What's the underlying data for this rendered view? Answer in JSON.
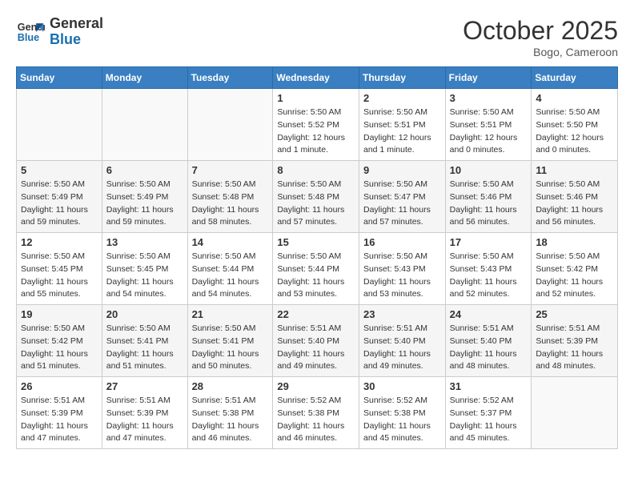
{
  "header": {
    "logo_line1": "General",
    "logo_line2": "Blue",
    "month": "October 2025",
    "location": "Bogo, Cameroon"
  },
  "weekdays": [
    "Sunday",
    "Monday",
    "Tuesday",
    "Wednesday",
    "Thursday",
    "Friday",
    "Saturday"
  ],
  "weeks": [
    [
      {
        "day": "",
        "info": ""
      },
      {
        "day": "",
        "info": ""
      },
      {
        "day": "",
        "info": ""
      },
      {
        "day": "1",
        "info": "Sunrise: 5:50 AM\nSunset: 5:52 PM\nDaylight: 12 hours\nand 1 minute."
      },
      {
        "day": "2",
        "info": "Sunrise: 5:50 AM\nSunset: 5:51 PM\nDaylight: 12 hours\nand 1 minute."
      },
      {
        "day": "3",
        "info": "Sunrise: 5:50 AM\nSunset: 5:51 PM\nDaylight: 12 hours\nand 0 minutes."
      },
      {
        "day": "4",
        "info": "Sunrise: 5:50 AM\nSunset: 5:50 PM\nDaylight: 12 hours\nand 0 minutes."
      }
    ],
    [
      {
        "day": "5",
        "info": "Sunrise: 5:50 AM\nSunset: 5:49 PM\nDaylight: 11 hours\nand 59 minutes."
      },
      {
        "day": "6",
        "info": "Sunrise: 5:50 AM\nSunset: 5:49 PM\nDaylight: 11 hours\nand 59 minutes."
      },
      {
        "day": "7",
        "info": "Sunrise: 5:50 AM\nSunset: 5:48 PM\nDaylight: 11 hours\nand 58 minutes."
      },
      {
        "day": "8",
        "info": "Sunrise: 5:50 AM\nSunset: 5:48 PM\nDaylight: 11 hours\nand 57 minutes."
      },
      {
        "day": "9",
        "info": "Sunrise: 5:50 AM\nSunset: 5:47 PM\nDaylight: 11 hours\nand 57 minutes."
      },
      {
        "day": "10",
        "info": "Sunrise: 5:50 AM\nSunset: 5:46 PM\nDaylight: 11 hours\nand 56 minutes."
      },
      {
        "day": "11",
        "info": "Sunrise: 5:50 AM\nSunset: 5:46 PM\nDaylight: 11 hours\nand 56 minutes."
      }
    ],
    [
      {
        "day": "12",
        "info": "Sunrise: 5:50 AM\nSunset: 5:45 PM\nDaylight: 11 hours\nand 55 minutes."
      },
      {
        "day": "13",
        "info": "Sunrise: 5:50 AM\nSunset: 5:45 PM\nDaylight: 11 hours\nand 54 minutes."
      },
      {
        "day": "14",
        "info": "Sunrise: 5:50 AM\nSunset: 5:44 PM\nDaylight: 11 hours\nand 54 minutes."
      },
      {
        "day": "15",
        "info": "Sunrise: 5:50 AM\nSunset: 5:44 PM\nDaylight: 11 hours\nand 53 minutes."
      },
      {
        "day": "16",
        "info": "Sunrise: 5:50 AM\nSunset: 5:43 PM\nDaylight: 11 hours\nand 53 minutes."
      },
      {
        "day": "17",
        "info": "Sunrise: 5:50 AM\nSunset: 5:43 PM\nDaylight: 11 hours\nand 52 minutes."
      },
      {
        "day": "18",
        "info": "Sunrise: 5:50 AM\nSunset: 5:42 PM\nDaylight: 11 hours\nand 52 minutes."
      }
    ],
    [
      {
        "day": "19",
        "info": "Sunrise: 5:50 AM\nSunset: 5:42 PM\nDaylight: 11 hours\nand 51 minutes."
      },
      {
        "day": "20",
        "info": "Sunrise: 5:50 AM\nSunset: 5:41 PM\nDaylight: 11 hours\nand 51 minutes."
      },
      {
        "day": "21",
        "info": "Sunrise: 5:50 AM\nSunset: 5:41 PM\nDaylight: 11 hours\nand 50 minutes."
      },
      {
        "day": "22",
        "info": "Sunrise: 5:51 AM\nSunset: 5:40 PM\nDaylight: 11 hours\nand 49 minutes."
      },
      {
        "day": "23",
        "info": "Sunrise: 5:51 AM\nSunset: 5:40 PM\nDaylight: 11 hours\nand 49 minutes."
      },
      {
        "day": "24",
        "info": "Sunrise: 5:51 AM\nSunset: 5:40 PM\nDaylight: 11 hours\nand 48 minutes."
      },
      {
        "day": "25",
        "info": "Sunrise: 5:51 AM\nSunset: 5:39 PM\nDaylight: 11 hours\nand 48 minutes."
      }
    ],
    [
      {
        "day": "26",
        "info": "Sunrise: 5:51 AM\nSunset: 5:39 PM\nDaylight: 11 hours\nand 47 minutes."
      },
      {
        "day": "27",
        "info": "Sunrise: 5:51 AM\nSunset: 5:39 PM\nDaylight: 11 hours\nand 47 minutes."
      },
      {
        "day": "28",
        "info": "Sunrise: 5:51 AM\nSunset: 5:38 PM\nDaylight: 11 hours\nand 46 minutes."
      },
      {
        "day": "29",
        "info": "Sunrise: 5:52 AM\nSunset: 5:38 PM\nDaylight: 11 hours\nand 46 minutes."
      },
      {
        "day": "30",
        "info": "Sunrise: 5:52 AM\nSunset: 5:38 PM\nDaylight: 11 hours\nand 45 minutes."
      },
      {
        "day": "31",
        "info": "Sunrise: 5:52 AM\nSunset: 5:37 PM\nDaylight: 11 hours\nand 45 minutes."
      },
      {
        "day": "",
        "info": ""
      }
    ]
  ]
}
